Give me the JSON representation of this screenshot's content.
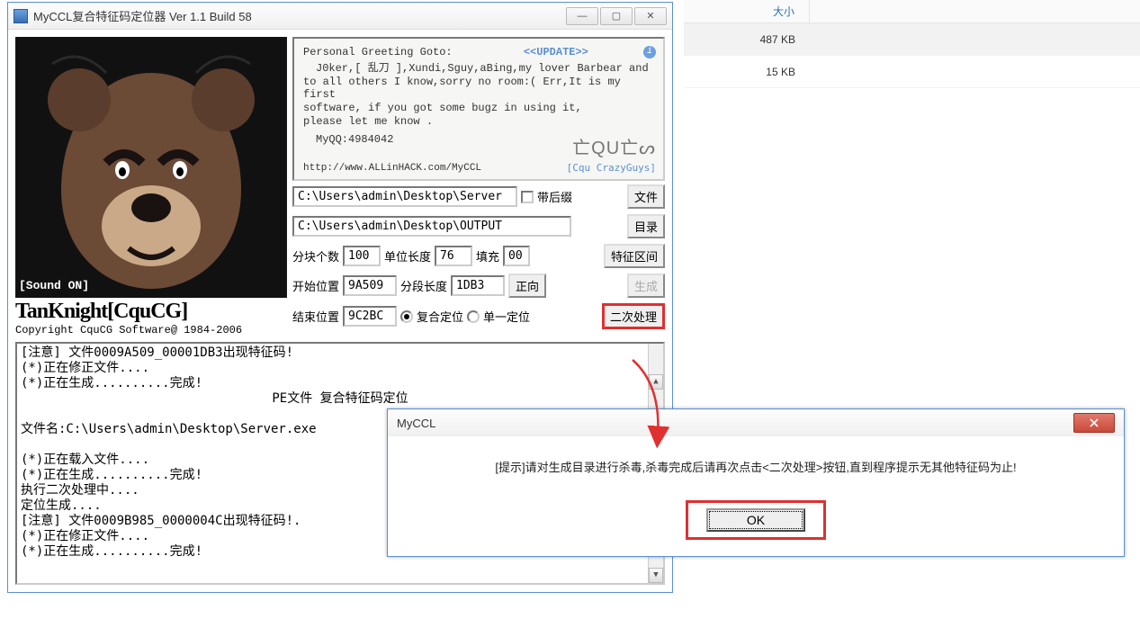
{
  "window": {
    "title": "MyCCL复合特征码定位器  Ver 1.1  Build 58",
    "minimize_glyph": "—",
    "maximize_glyph": "▢",
    "close_glyph": "✕"
  },
  "greeting": {
    "header": "Personal Greeting Goto:",
    "update": "<<UPDATE>>",
    "line1": "J0ker,[ 乱刀 ],Xundi,Sguy,aBing,my lover Barbear and",
    "line2": "to all others I know,sorry no room:(  Err,It is my first",
    "line3": "software, if you got some bugz in using it,",
    "line4": "please let me know .",
    "qq": "MyQQ:4984042",
    "url": "http://www.ALLinHACK.com/MyCCL",
    "brand": "亡QU亡ᔕ",
    "crazy": "[Cqu CrazyGuys]",
    "info_glyph": "i"
  },
  "bear": {
    "sound_on": "[Sound ON]",
    "credit_big": "TanKnight[CquCG]",
    "credit_small": "Copyright CquCG Software@ 1984-2006"
  },
  "form": {
    "file_path": "C:\\Users\\admin\\Desktop\\Server",
    "suffix_label": "带后缀",
    "file_btn": "文件",
    "output_path": "C:\\Users\\admin\\Desktop\\OUTPUT",
    "dir_btn": "目录",
    "block_count_label": "分块个数",
    "block_count": "100",
    "unit_len_label": "单位长度",
    "unit_len": "76",
    "fill_label": "填充",
    "fill": "00",
    "feature_btn": "特征区间",
    "start_pos_label": "开始位置",
    "start_pos": "9A509",
    "seg_len_label": "分段长度",
    "seg_len": "1DB3",
    "forward_btn": "正向",
    "generate_btn": "生成",
    "end_pos_label": "结束位置",
    "end_pos": "9C2BC",
    "compound_label": "复合定位",
    "single_label": "单一定位",
    "reprocess_btn": "二次处理"
  },
  "log": {
    "l1": "[注意] 文件0009A509_00001DB3出现特征码!",
    "l2": "(*)正在修正文件....",
    "l3": "(*)正在生成..........完成!",
    "l4": "PE文件 复合特征码定位",
    "l5": "文件名:C:\\Users\\admin\\Desktop\\Server.exe",
    "l6": "(*)正在载入文件....",
    "l7": "(*)正在生成..........完成!",
    "l8": "执行二次处理中....",
    "l9": "定位生成....",
    "l10": "[注意] 文件0009B985_0000004C出现特征码!.",
    "l11": "(*)正在修正文件....",
    "l12": "(*)正在生成..........完成!"
  },
  "filelist": {
    "col_size": "大小",
    "row1_size": "487 KB",
    "row2_size": "15 KB"
  },
  "dialog": {
    "title": "MyCCL",
    "message": "[提示]请对生成目录进行杀毒,杀毒完成后请再次点击<二次处理>按钮,直到程序提示无其他特征码为止!",
    "ok": "OK"
  }
}
